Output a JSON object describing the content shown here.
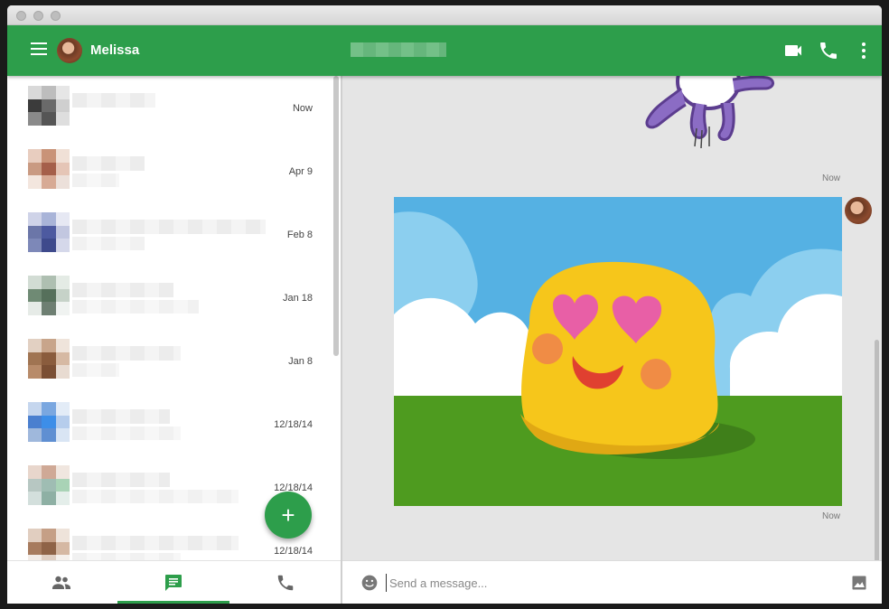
{
  "app": {
    "contact_name": "Melissa",
    "accent_color": "#2d9e4b"
  },
  "header": {
    "icons": [
      "menu-icon",
      "video-call-icon",
      "phone-icon",
      "more-vert-icon"
    ]
  },
  "conversations": [
    {
      "date": "Now"
    },
    {
      "date": "Apr 9"
    },
    {
      "date": "Feb 8"
    },
    {
      "date": "Jan 18"
    },
    {
      "date": "Jan 8"
    },
    {
      "date": "12/18/14"
    },
    {
      "date": "12/18/14"
    },
    {
      "date": "12/18/14"
    }
  ],
  "fab": {
    "label": "+"
  },
  "bottom_nav": {
    "items": [
      "people-icon",
      "chat-icon",
      "phone-icon"
    ],
    "selected": 1
  },
  "chat": {
    "messages": [
      {
        "type": "sticker",
        "timestamp": "Now"
      },
      {
        "type": "sticker",
        "timestamp": "Now"
      }
    ]
  },
  "input": {
    "placeholder": "Send a message..."
  }
}
